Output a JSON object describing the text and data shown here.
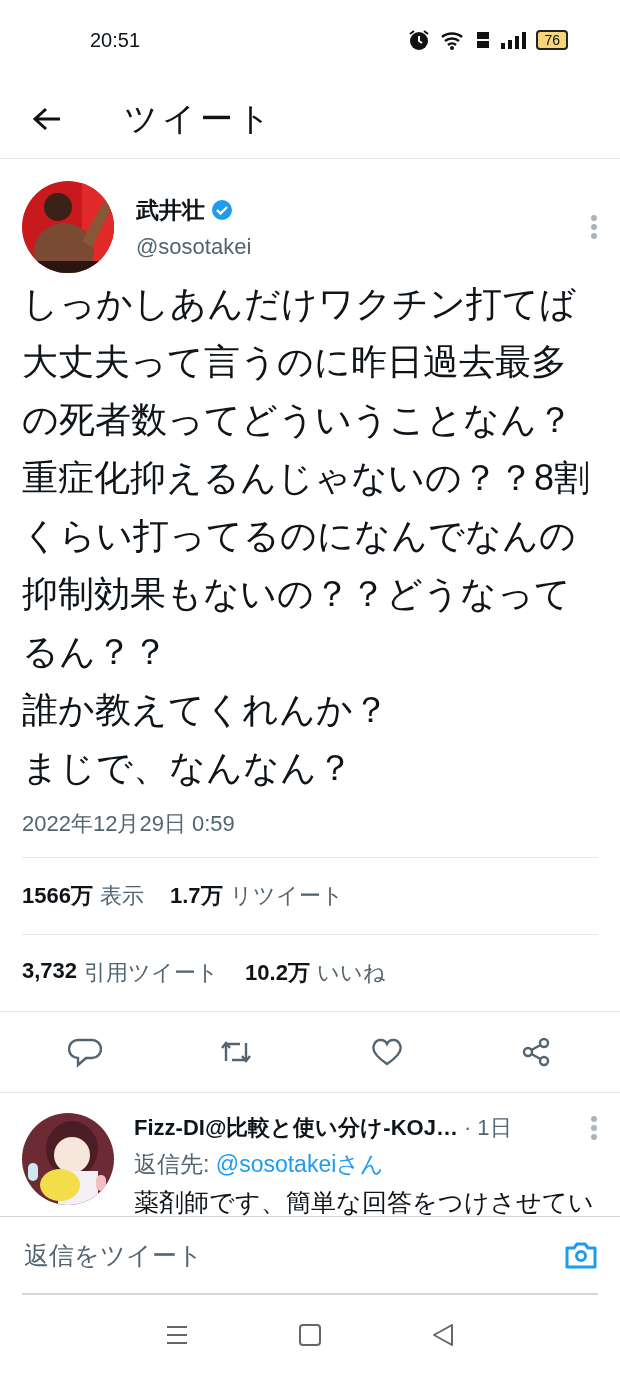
{
  "status_bar": {
    "time": "20:51",
    "battery": "76"
  },
  "header": {
    "title": "ツイート"
  },
  "tweet": {
    "author": {
      "name": "武井壮",
      "handle": "@sosotakei",
      "verified": true
    },
    "paragraphs": [
      "しっかしあんだけワクチン打てば大丈夫って言うのに昨日過去最多の死者数ってどういうことなん？重症化抑えるんじゃないの？？8割くらい打ってるのになんでなんの抑制効果もないの？？どうなってるん？？",
      "誰か教えてくれんか？",
      "まじで、なんなん？"
    ],
    "timestamp": "2022年12月29日 0:59",
    "stats": [
      {
        "count": "1566万",
        "label": "表示"
      },
      {
        "count": "1.7万",
        "label": "リツイート"
      },
      {
        "count": "3,732",
        "label": "引用ツイート"
      },
      {
        "count": "10.2万",
        "label": "いいね"
      }
    ]
  },
  "reply": {
    "name": "Fizz-DI@比較と使い分け-KOJ…",
    "time": "· 1日",
    "reply_to_label": "返信先:",
    "reply_to": "@sosotakeiさん",
    "text": "薬剤師です、簡単な回答をつけさせてい"
  },
  "compose": {
    "placeholder": "返信をツイート"
  }
}
